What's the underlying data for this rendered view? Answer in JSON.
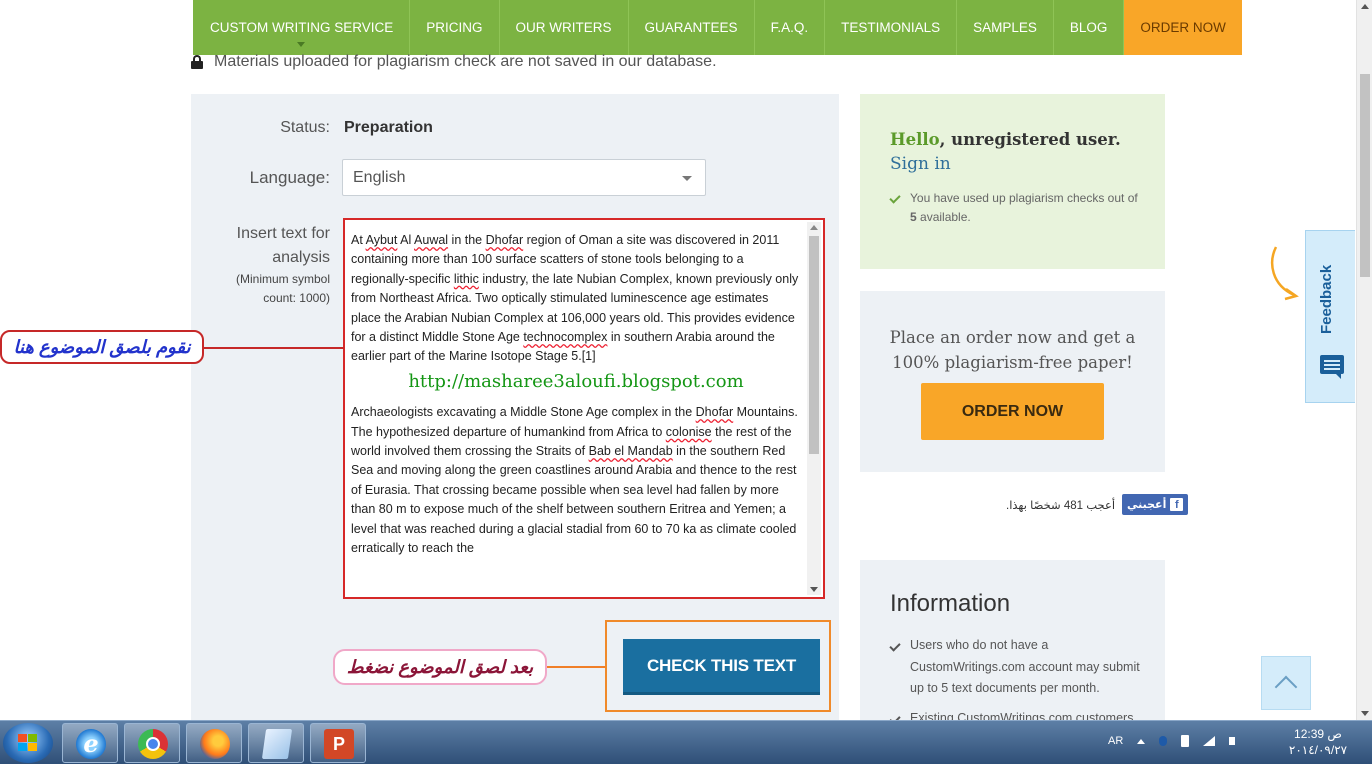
{
  "nav": {
    "items": [
      {
        "label": "CUSTOM WRITING SERVICE"
      },
      {
        "label": "PRICING"
      },
      {
        "label": "OUR WRITERS"
      },
      {
        "label": "GUARANTEES"
      },
      {
        "label": "F.A.Q."
      },
      {
        "label": "TESTIMONIALS"
      },
      {
        "label": "SAMPLES"
      },
      {
        "label": "BLOG"
      }
    ],
    "order_label": "ORDER NOW",
    "green": "#7cb342",
    "orange": "#f9a628"
  },
  "notice": {
    "icon": "lock-icon",
    "text": "Materials uploaded for plagiarism check are not saved in our database."
  },
  "form": {
    "status_label": "Status:",
    "status_value": "Preparation",
    "language_label": "Language:",
    "language_value": "English",
    "insert_label": "Insert text for analysis",
    "min_label": "(Minimum symbol count: 1000)",
    "text": {
      "p1_a": "At ",
      "p1_s1": "Aybut",
      "p1_b": " Al ",
      "p1_s2": "Auwal",
      "p1_c": " in the ",
      "p1_s3": "Dhofar",
      "p1_d": " region of Oman a site was discovered in 2011 containing more than 100 surface scatters of stone tools belonging to a regionally-specific ",
      "p1_s4": "lithic",
      "p1_e": " industry, the late Nubian Complex, known previously only from Northeast Africa. Two optically stimulated luminescence age estimates place the Arabian Nubian Complex at 106,000 years old. This provides evidence for a distinct Middle Stone Age ",
      "p1_s5": "technocomplex",
      "p1_f": " in southern Arabia around the earlier part of the Marine Isotope Stage 5.[1]",
      "watermark": "http://masharee3aloufi.blogspot.com",
      "p2_a": "Archaeologists excavating a Middle Stone Age complex in the ",
      "p2_s1": "Dhofar",
      "p2_b": " Mountains.",
      "p3_a": "The hypothesized departure of humankind from Africa to ",
      "p3_s1": "colonise",
      "p3_b": " the rest of the world involved them crossing the Straits of ",
      "p3_s2": "Bab el Mandab",
      "p3_c": " in the southern Red Sea and moving along the green coastlines around Arabia and thence to the rest of Eurasia. That crossing became possible when sea level had fallen by more than 80 m to expose much of the shelf between southern Eritrea and Yemen; a level that was reached during a glacial stadial from 60 to 70 ka as climate cooled erratically to reach the"
    },
    "check_button": "CHECK THIS TEXT",
    "accent": "#1a6fa0"
  },
  "annotations": {
    "paste_here": "نقوم بلصق الموضوع هنا",
    "after_paste": "بعد لصق الموضوع نضغط"
  },
  "sidebar": {
    "hello_word": "Hello",
    "hello_rest": ", unregistered user.",
    "sign_in": "Sign in",
    "checks_note_a": "You have used up plagiarism checks out of ",
    "checks_count": "5",
    "checks_note_b": " available.",
    "promo_line1": "Place an order now and get a",
    "promo_line2": "100% plagiarism-free paper!",
    "order_button": "ORDER NOW",
    "fb_like": "أعجبني",
    "fb_count": "أعجب 481 شخصًا بهذا.",
    "info_title": "Information",
    "info_items": [
      "Users who do not have a CustomWritings.com account may submit up to 5 text documents per month.",
      "Existing CustomWritings.com customers"
    ],
    "feedback_label": "Feedback"
  },
  "taskbar": {
    "lang": "AR",
    "time": "12:39 ص",
    "date": "٢٠١٤/٠٩/٢٧",
    "apps": [
      "internet-explorer-icon",
      "chrome-icon",
      "firefox-icon",
      "notepad-icon",
      "powerpoint-icon"
    ]
  }
}
